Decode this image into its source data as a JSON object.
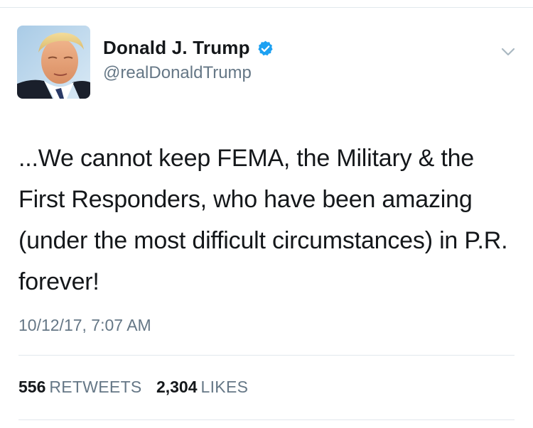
{
  "author": {
    "display_name": "Donald J. Trump",
    "handle": "@realDonaldTrump",
    "verified": true,
    "avatar_icon": "profile-photo",
    "verified_icon": "verified-badge-icon",
    "menu_icon": "chevron-down-icon"
  },
  "tweet": {
    "text": "...We cannot keep FEMA, the Military & the First Responders, who have been amazing (under the most difficult circumstances) in P.R. forever!",
    "timestamp": "10/12/17, 7:07 AM"
  },
  "stats": {
    "retweets_count": "556",
    "retweets_label": "RETWEETS",
    "likes_count": "2,304",
    "likes_label": "LIKES"
  },
  "colors": {
    "text_primary": "#14171a",
    "text_secondary": "#657786",
    "verified_blue": "#1da1f2",
    "divider": "#e1e8ed"
  }
}
